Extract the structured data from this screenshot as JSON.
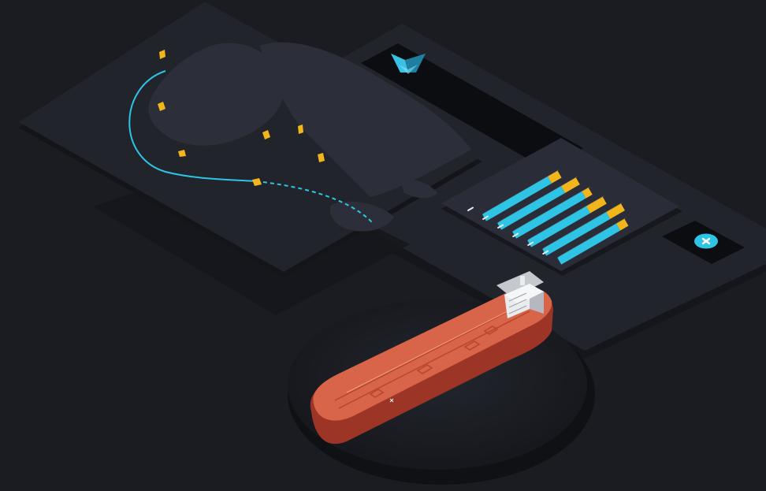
{
  "scene": {
    "background_color": "#1b1c22",
    "panel_color": "#22242c",
    "panel_edge_color": "#15161b",
    "map_land_color": "#2c2f39",
    "route_color": "#2ec4e6",
    "vessel_marker_color": "#f2b51c",
    "tanker_hull_color": "#d8644a",
    "tanker_deck_color": "#e07055",
    "tanker_bridge_color": "#e9ecef"
  },
  "logo": {
    "icon": "chevron-logo-icon",
    "color": "#3bc1e3"
  },
  "close_button": {
    "icon": "close-icon",
    "color": "#2ec4e6"
  },
  "chart_data": {
    "type": "bar",
    "orientation": "horizontal-stacked",
    "categories": [
      "",
      "",
      "",
      "",
      "",
      ""
    ],
    "series": [
      {
        "values": [
          80,
          78,
          85,
          72,
          78,
          72
        ]
      },
      {
        "values": [
          12,
          18,
          8,
          20,
          18,
          10
        ]
      }
    ],
    "series_colors": [
      "#2ec4e6",
      "#f2b51c"
    ],
    "xlim": [
      0,
      100
    ]
  }
}
